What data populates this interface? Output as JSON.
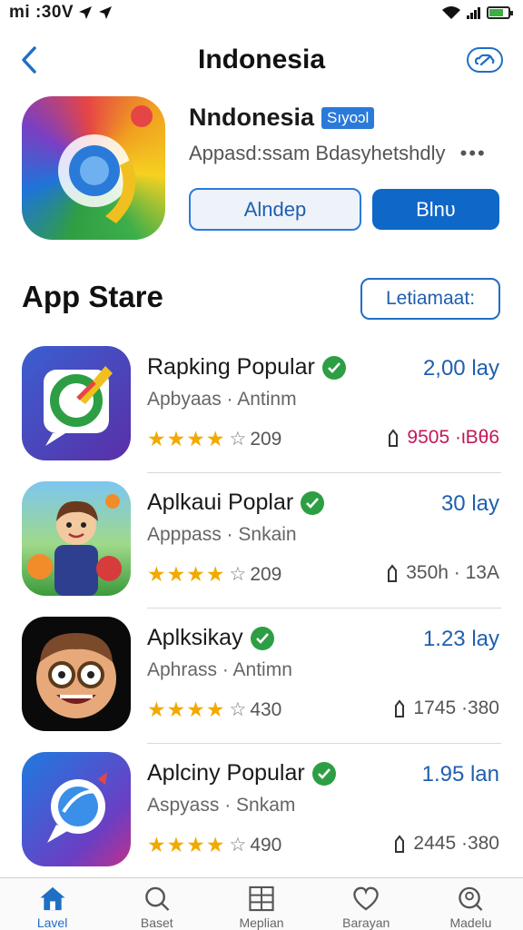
{
  "status_bar": {
    "time": "mi :30V",
    "battery_level": 0.75
  },
  "header": {
    "title": "Indonesia"
  },
  "hero": {
    "name": "Nndonesia",
    "badge": "Sıyoɔl",
    "subtitle": "Appasd:ssam Bdasyhetshdly",
    "more": "•••",
    "button_outline": "Alndep",
    "button_solid": "Blnʋ"
  },
  "section": {
    "title": "App Stare",
    "button": "Letiamaat:"
  },
  "apps": [
    {
      "name": "Rapking Popular",
      "subtitle": "Apbyaas · Antinm",
      "size": "2,00 lay",
      "rating_text": "209",
      "stars": 4,
      "stat": "9505 ·ιΒθ6"
    },
    {
      "name": "Aplkaui Poplar",
      "subtitle": "Apppass · Snkain",
      "size": "30 lay",
      "rating_text": "209",
      "stars": 4,
      "stat": "350h · 13A"
    },
    {
      "name": "Aplksikay",
      "subtitle": "Aphrass · Antimn",
      "size": "1.23 lay",
      "rating_text": "430",
      "stars": 4,
      "stat": "1745 ·380"
    },
    {
      "name": "Aplciny Popular",
      "subtitle": "Aspyass · Snkam",
      "size": "1.95 lan",
      "rating_text": "490",
      "stars": 4,
      "stat": "2445 ·380"
    }
  ],
  "tabs": [
    {
      "label": "Lavel",
      "icon": "home-icon",
      "active": true
    },
    {
      "label": "Baset",
      "icon": "search-icon",
      "active": false
    },
    {
      "label": "Meplian",
      "icon": "grid-icon",
      "active": false
    },
    {
      "label": "Barayan",
      "icon": "heart-icon",
      "active": false
    },
    {
      "label": "Madelu",
      "icon": "profile-search-icon",
      "active": false
    }
  ],
  "colors": {
    "accent": "#1f6fc4",
    "verified": "#2e9e44",
    "star": "#f2a900"
  }
}
